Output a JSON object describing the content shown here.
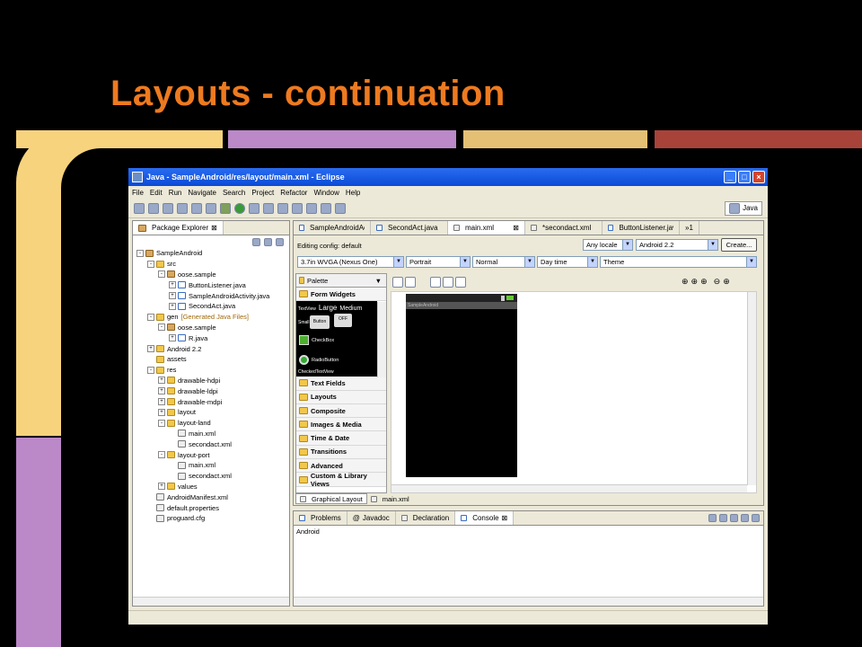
{
  "slide": {
    "title": "Layouts - continuation",
    "bar_colors": [
      "#f7d37d",
      "#bb88c8",
      "#e4c074",
      "#a8433a"
    ]
  },
  "window": {
    "title": "Java - SampleAndroid/res/layout/main.xml - Eclipse",
    "menu": [
      "File",
      "Edit",
      "Run",
      "Navigate",
      "Search",
      "Project",
      "Refactor",
      "Window",
      "Help"
    ],
    "perspective": "Java"
  },
  "package_explorer": {
    "tab": "Package Explorer",
    "tree": [
      {
        "label": "SampleAndroid",
        "depth": 0,
        "kind": "project",
        "toggle": "-"
      },
      {
        "label": "src",
        "depth": 1,
        "kind": "folder",
        "toggle": "-"
      },
      {
        "label": "oose.sample",
        "depth": 2,
        "kind": "pkg",
        "toggle": "-"
      },
      {
        "label": "ButtonListener.java",
        "depth": 3,
        "kind": "java",
        "toggle": "+"
      },
      {
        "label": "SampleAndroidActivity.java",
        "depth": 3,
        "kind": "java",
        "toggle": "+"
      },
      {
        "label": "SecondAct.java",
        "depth": 3,
        "kind": "java",
        "toggle": "+"
      },
      {
        "label": "gen",
        "depth": 1,
        "kind": "folder",
        "toggle": "-",
        "suffix": "[Generated Java Files]"
      },
      {
        "label": "oose.sample",
        "depth": 2,
        "kind": "pkg",
        "toggle": "-"
      },
      {
        "label": "R.java",
        "depth": 3,
        "kind": "java",
        "toggle": "+"
      },
      {
        "label": "Android 2.2",
        "depth": 1,
        "kind": "lib",
        "toggle": "+"
      },
      {
        "label": "assets",
        "depth": 1,
        "kind": "folder",
        "toggle": ""
      },
      {
        "label": "res",
        "depth": 1,
        "kind": "folder",
        "toggle": "-"
      },
      {
        "label": "drawable-hdpi",
        "depth": 2,
        "kind": "folder",
        "toggle": "+"
      },
      {
        "label": "drawable-ldpi",
        "depth": 2,
        "kind": "folder",
        "toggle": "+"
      },
      {
        "label": "drawable-mdpi",
        "depth": 2,
        "kind": "folder",
        "toggle": "+"
      },
      {
        "label": "layout",
        "depth": 2,
        "kind": "folder",
        "toggle": "+"
      },
      {
        "label": "layout-land",
        "depth": 2,
        "kind": "folder",
        "toggle": "-"
      },
      {
        "label": "main.xml",
        "depth": 3,
        "kind": "xml",
        "toggle": ""
      },
      {
        "label": "secondact.xml",
        "depth": 3,
        "kind": "xml",
        "toggle": ""
      },
      {
        "label": "layout-port",
        "depth": 2,
        "kind": "folder",
        "toggle": "-"
      },
      {
        "label": "main.xml",
        "depth": 3,
        "kind": "xml",
        "toggle": ""
      },
      {
        "label": "secondact.xml",
        "depth": 3,
        "kind": "xml",
        "toggle": ""
      },
      {
        "label": "values",
        "depth": 2,
        "kind": "folder",
        "toggle": "+"
      },
      {
        "label": "AndroidManifest.xml",
        "depth": 1,
        "kind": "xml",
        "toggle": ""
      },
      {
        "label": "default.properties",
        "depth": 1,
        "kind": "file",
        "toggle": ""
      },
      {
        "label": "proguard.cfg",
        "depth": 1,
        "kind": "file",
        "toggle": ""
      }
    ]
  },
  "editor": {
    "tabs": [
      "SampleAndroidActivit",
      "SecondAct.java",
      "main.xml",
      "*secondact.xml",
      "ButtonListener.java"
    ],
    "active_tab": "main.xml",
    "overflow": "»1",
    "editing_config": "Editing config: default",
    "locale": "Any locale",
    "target": "Android 2.2",
    "create": "Create...",
    "device": "3.7in WVGA (Nexus One)",
    "orientation": "Portrait",
    "mode": "Normal",
    "time": "Day time",
    "theme": "Theme",
    "palette": "Palette",
    "palette_categories": [
      "Form Widgets",
      "Text Fields",
      "Layouts",
      "Composite",
      "Images & Media",
      "Time & Date",
      "Transitions",
      "Advanced",
      "Custom & Library Views"
    ],
    "widgets": {
      "textview": "TextView",
      "large": "Large",
      "medium": "Medium",
      "small": "Small",
      "button": "Button",
      "off": "OFF",
      "checkbox": "CheckBox",
      "radiobutton": "RadioButton",
      "checkedtextview": "CheckedTextView"
    },
    "device_label": "SampleAndroid",
    "bottom_tabs": [
      "Graphical Layout",
      "main.xml"
    ]
  },
  "console": {
    "tabs": [
      "Problems",
      "Javadoc",
      "Declaration",
      "Console"
    ],
    "active_tab": "Console",
    "text": "Android"
  }
}
